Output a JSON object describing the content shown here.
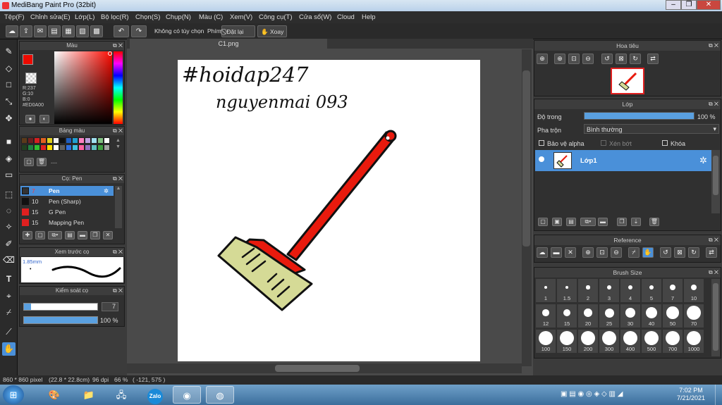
{
  "app": {
    "title": "MediBang Paint Pro (32bit)"
  },
  "menu": [
    "Tệp(F)",
    "Chỉnh sửa(E)",
    "Lớp(L)",
    "Bộ lọc(R)",
    "Chọn(S)",
    "Chụp(N)",
    "Màu (C)",
    "Xem(V)",
    "Công cụ(T)",
    "Cửa sổ(W)",
    "Cloud",
    "Help"
  ],
  "toolbar": {
    "no_options": "Không có tùy chọn",
    "key_label": "Phím",
    "reset_label": "Đặt lại",
    "rotate_label": "Xoay"
  },
  "color_panel": {
    "title": "Màu",
    "r": "R:237",
    "g": "G:10",
    "b": "B:0",
    "hex": "#ED0A00",
    "primary": "#ED0A00"
  },
  "palette_panel": {
    "title": "Bảng màu",
    "empty": "---",
    "swatches": [
      "#5a3a1a",
      "#6a2020",
      "#d42020",
      "#e06020",
      "#e0d020",
      "#f0f0f0",
      "#111111",
      "#2060c0",
      "#20a0d0",
      "#ff80c0",
      "#c0a0e0",
      "#a0e0f0",
      "#80c080",
      "#ffffff",
      "#204020",
      "#208040",
      "#30c030",
      "#e02020",
      "#ffe000",
      "#ffffff",
      "#606060",
      "#3070e0",
      "#40c0e0",
      "#ff60a0",
      "#9070c0",
      "#60c0c0",
      "#40a040",
      "#a0a0a0"
    ]
  },
  "brush_panel": {
    "title": "Cọ: Pen",
    "items": [
      {
        "size": "7",
        "name": "Pen",
        "color": "#ED0A00"
      },
      {
        "size": "10",
        "name": "Pen (Sharp)",
        "color": "#111111"
      },
      {
        "size": "15",
        "name": "G Pen",
        "color": "#e02020"
      },
      {
        "size": "15",
        "name": "Mapping Pen",
        "color": "#e02020"
      }
    ]
  },
  "preview_panel": {
    "title": "Xem trước cọ",
    "size": "1.85mm"
  },
  "brush_control": {
    "title": "Kiểm soát cọ",
    "size_value": "7",
    "size_fraction": 0.1,
    "opacity": "100 %",
    "opacity_fraction": 1.0
  },
  "canvas": {
    "tab_title": "C1.png",
    "text_line1": "#hoidap247",
    "text_line2": "nguyenmai 093"
  },
  "status": {
    "size": "860 * 860 pixel",
    "dims": "(22.8 * 22.8cm)",
    "dpi": "96 dpi",
    "zoom": "66 %",
    "coords": "( -121, 575 )"
  },
  "navigator": {
    "title": "Hoa tiêu"
  },
  "layer_panel": {
    "title": "Lớp",
    "opacity_label": "Độ trong",
    "opacity_value": "100 %",
    "opacity_fraction": 1.0,
    "blend_label": "Pha trộn",
    "blend_value": "Bình thường",
    "alpha_protect": "Bảo vệ alpha",
    "clipping": "Xén bớt",
    "lock": "Khóa",
    "layer_name": "Lớp1"
  },
  "reference_panel": {
    "title": "Reference"
  },
  "brush_size_panel": {
    "title": "Brush Size",
    "sizes": [
      "1",
      "1.5",
      "2",
      "3",
      "4",
      "5",
      "7",
      "10",
      "12",
      "15",
      "20",
      "25",
      "30",
      "40",
      "50",
      "70",
      "100",
      "150",
      "200",
      "300",
      "400",
      "500",
      "700",
      "1000"
    ]
  },
  "taskbar": {
    "time": "7:02 PM",
    "date": "7/21/2021",
    "zalo_label": "Zalo"
  }
}
